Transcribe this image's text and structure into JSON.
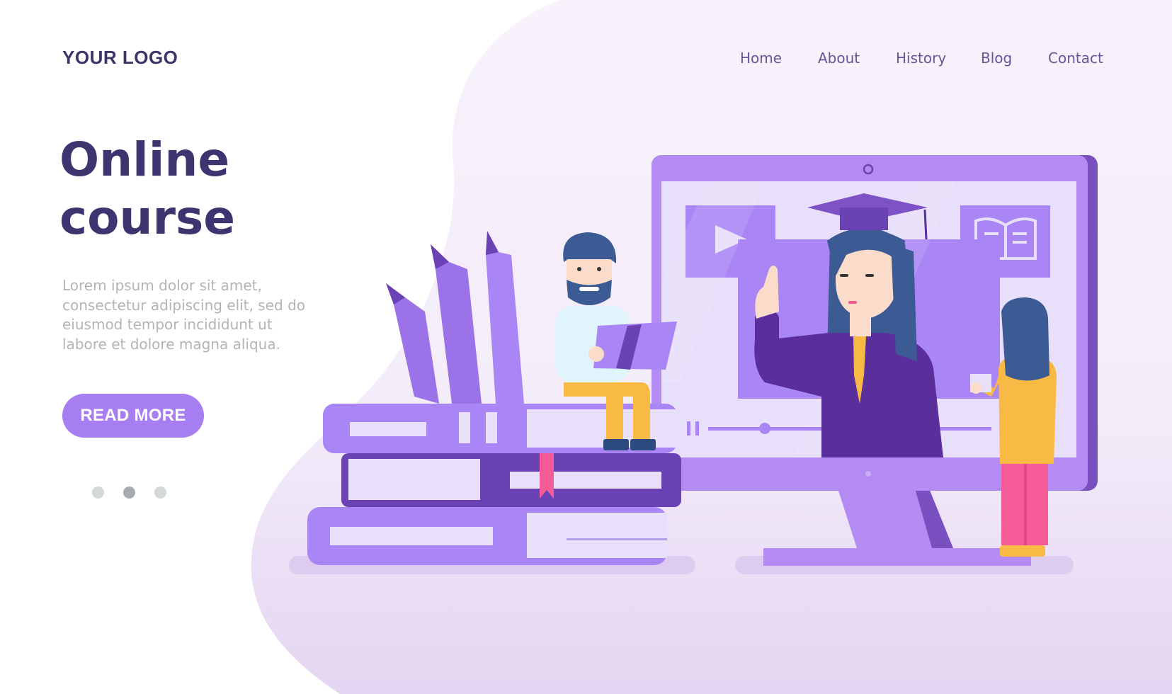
{
  "header": {
    "logo": "YOUR LOGO",
    "nav": [
      {
        "label": "Home"
      },
      {
        "label": "About"
      },
      {
        "label": "History"
      },
      {
        "label": "Blog"
      },
      {
        "label": "Contact"
      }
    ]
  },
  "hero": {
    "title_line1": "Online",
    "title_line2": "course",
    "description": "Lorem ipsum dolor sit amet, consectetur adipiscing elit, sed do eiusmod tempor incididunt ut labore et dolore magna aliqua.",
    "cta_label": "READ MORE"
  },
  "carousel": {
    "total_slides": 3,
    "active_slide": 2
  },
  "illustration": {
    "subject": "online course",
    "video_player": {
      "state": "paused",
      "progress": 0.2
    }
  },
  "colors": {
    "title": "#3f3470",
    "nav": "#6b5497",
    "accent": "#a67ef2",
    "monitor": "#b38bf2",
    "monitor_dark": "#7a4fbf",
    "screen": "#e8dffb",
    "pencil": "#9b72e8",
    "bookmark": "#f55b97",
    "skin": "#fbdccb",
    "hair": "#3c5a94",
    "yellow": "#f8b945",
    "pants_pink": "#f55b97",
    "shirt_light": "#dff4fb"
  }
}
